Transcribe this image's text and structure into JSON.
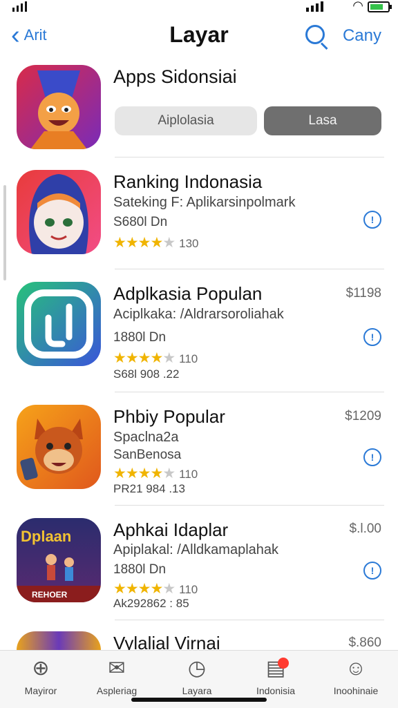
{
  "nav": {
    "back_label": "Arit",
    "title": "Layar",
    "right_label": "Cany"
  },
  "header": {
    "title": "Apps Sidonsiai",
    "segments": [
      "Aiplolasia",
      "Lasa"
    ]
  },
  "apps": [
    {
      "name": "Ranking Indonasia",
      "subtitle": "Sateking F: Aplikarsinpolmark",
      "meta1": "S680l Dn",
      "rating": 4.5,
      "rating_count": "130",
      "price": "",
      "meta2": ""
    },
    {
      "name": "Adplkasia Populan",
      "subtitle": "Aciplkaka: /Aldrarsoroliahak",
      "meta1": "1880l Dn",
      "rating": 4.5,
      "rating_count": "110",
      "price": "$1198",
      "meta2": "S68l 908 .22"
    },
    {
      "name": "Phbiy Popular",
      "subtitle": "Spaclna2a",
      "meta1": "SanBenosa",
      "rating": 4.5,
      "rating_count": "110",
      "price": "$1209",
      "meta2": "PR21 984 .13"
    },
    {
      "name": "Aphkai Idaplar",
      "subtitle": "Apiplakal: /Alldkamaplahak",
      "meta1": "1880l Dn",
      "rating": 4.5,
      "rating_count": "110",
      "price": "$.l.00",
      "meta2": "Ak292862 : 85"
    },
    {
      "name": "Vylalial Virnai",
      "subtitle": "",
      "meta1": "",
      "rating": null,
      "rating_count": "",
      "price": "$.860",
      "meta2": ""
    }
  ],
  "icon_text": {
    "dplaan": "Dplaan",
    "footer": "REHOER"
  },
  "tabs": [
    {
      "label": "Mayiror",
      "icon": "compass-icon"
    },
    {
      "label": "Aspleriag",
      "icon": "messages-icon"
    },
    {
      "label": "Layara",
      "icon": "clock-icon"
    },
    {
      "label": "Indonisia",
      "icon": "calendar-icon"
    },
    {
      "label": "Inoohinaie",
      "icon": "person-icon"
    }
  ],
  "colors": {
    "accent": "#2a79d6",
    "star": "#f0b400",
    "badge": "#ff3b30"
  }
}
